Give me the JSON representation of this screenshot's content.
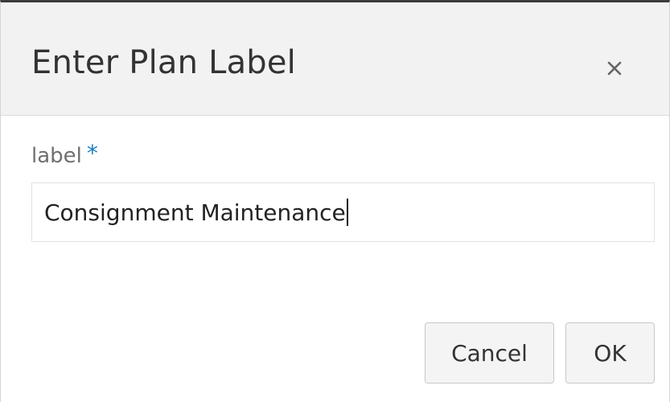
{
  "dialog": {
    "title": "Enter Plan Label",
    "close_icon": "close-icon"
  },
  "form": {
    "label": "label",
    "required_marker": "*",
    "input_value": "Consignment Maintenance"
  },
  "buttons": {
    "cancel_label": "Cancel",
    "ok_label": "OK"
  },
  "colors": {
    "header_bg": "#f2f2f2",
    "required_star": "#1d7cc0",
    "button_bg": "#f4f4f4"
  }
}
